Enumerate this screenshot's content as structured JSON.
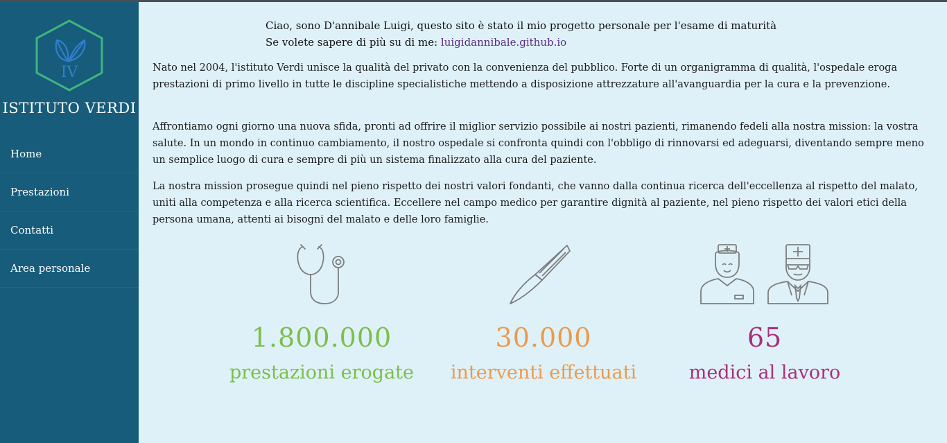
{
  "brand": {
    "logo_text": "IV",
    "name": "ISTITUTO VERDI"
  },
  "nav": [
    {
      "label": "Home"
    },
    {
      "label": "Prestazioni"
    },
    {
      "label": "Contatti"
    },
    {
      "label": "Area personale"
    }
  ],
  "intro": {
    "line1": "Ciao, sono D'annibale Luigi, questo sito è stato il mio progetto personale per l'esame di maturità",
    "line2_prefix": "Se volete sapere di più su di me: ",
    "link_text": "luigidannibale.github.io"
  },
  "paragraphs": [
    "Nato nel 2004, l'istituto Verdi unisce la qualità del privato con la convenienza del pubblico. Forte di un organigramma di qualità, l'ospedale eroga prestazioni di primo livello in tutte le discipline specialistiche mettendo a disposizione attrezzature all'avanguardia per la cura e la prevenzione.",
    "Affrontiamo ogni giorno una nuova sfida, pronti ad offrire il miglior servizio possibile ai nostri pazienti, rimanendo fedeli alla nostra mission: la vostra salute. In un mondo in continuo cambiamento, il nostro ospedale si confronta quindi con l'obbligo di rinnovarsi ed adeguarsi, diventando sempre meno un semplice luogo di cura e sempre di più un sistema finalizzato alla cura del paziente.",
    "La nostra mission prosegue quindi nel pieno rispetto dei nostri valori fondanti, che vanno dalla continua ricerca dell'eccellenza al rispetto del malato, uniti alla competenza e alla ricerca scientifica. Eccellere nel campo medico per garantire dignità al paziente, nel pieno rispetto dei valori etici della persona umana, attenti ai bisogni del malato e delle loro famiglie."
  ],
  "stats": [
    {
      "icon": "stethoscope-icon",
      "value": "1.800.000",
      "label": "prestazioni erogate",
      "color": "#7bbf4a"
    },
    {
      "icon": "scalpel-icon",
      "value": "30.000",
      "label": "interventi effettuati",
      "color": "#eb9a4b"
    },
    {
      "icon": "doctors-icon",
      "value": "65",
      "label": "medici al lavoro",
      "color": "#a8307a"
    }
  ],
  "colors": {
    "sidebar": "#175c7a",
    "background": "#dff1f8",
    "logo_border": "#3fb57f",
    "logo_icon": "#2f7fd0",
    "link": "#5b2a86",
    "icon_stroke": "#7d7d7d"
  }
}
